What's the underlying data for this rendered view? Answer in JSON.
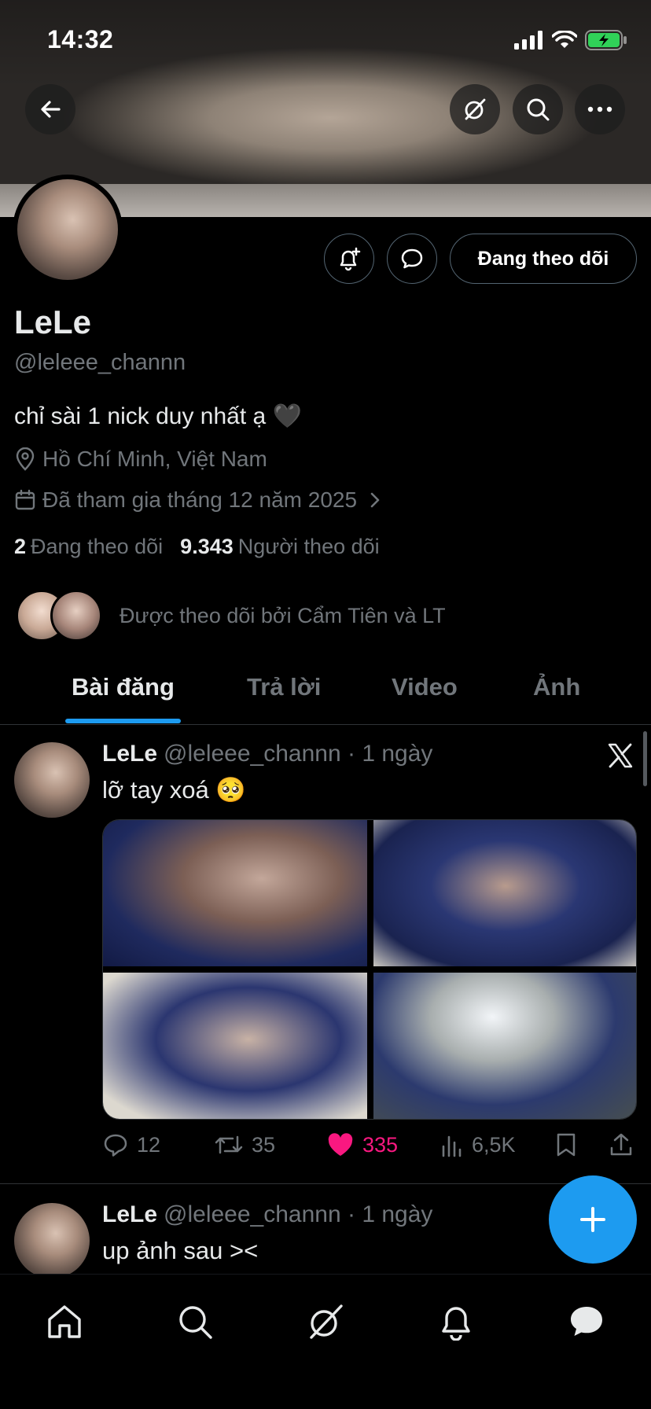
{
  "status_bar": {
    "time": "14:32"
  },
  "profile": {
    "name": "LeLe",
    "handle": "@leleee_channn",
    "bio": "chỉ sài 1 nick duy nhất ạ 🖤",
    "location": "Hồ Chí Minh, Việt Nam",
    "joined": "Đã tham gia tháng 12 năm 2025",
    "following_count": "2",
    "following_label": "Đang theo dõi",
    "followers_count": "9.343",
    "followers_label": "Người theo dõi",
    "followed_by": "Được theo dõi bởi Cẩm Tiên và LT",
    "follow_button": "Đang theo dõi"
  },
  "tabs": [
    {
      "label": "Bài đăng",
      "active": true
    },
    {
      "label": "Trả lời",
      "active": false
    },
    {
      "label": "Video",
      "active": false
    },
    {
      "label": "Ảnh",
      "active": false
    }
  ],
  "tweets": [
    {
      "name": "LeLe",
      "handle": "@leleee_channn",
      "time": "· 1 ngày",
      "text": "lỡ tay xoá 🥺",
      "replies": "12",
      "reposts": "35",
      "likes": "335",
      "views": "6,5K"
    },
    {
      "name": "LeLe",
      "handle": "@leleee_channn",
      "time": "· 1 ngày",
      "text": "up ảnh sau ><"
    }
  ],
  "colors": {
    "accent": "#1d9bf0",
    "like": "#f91880",
    "muted": "#71767b",
    "background": "#000000"
  }
}
